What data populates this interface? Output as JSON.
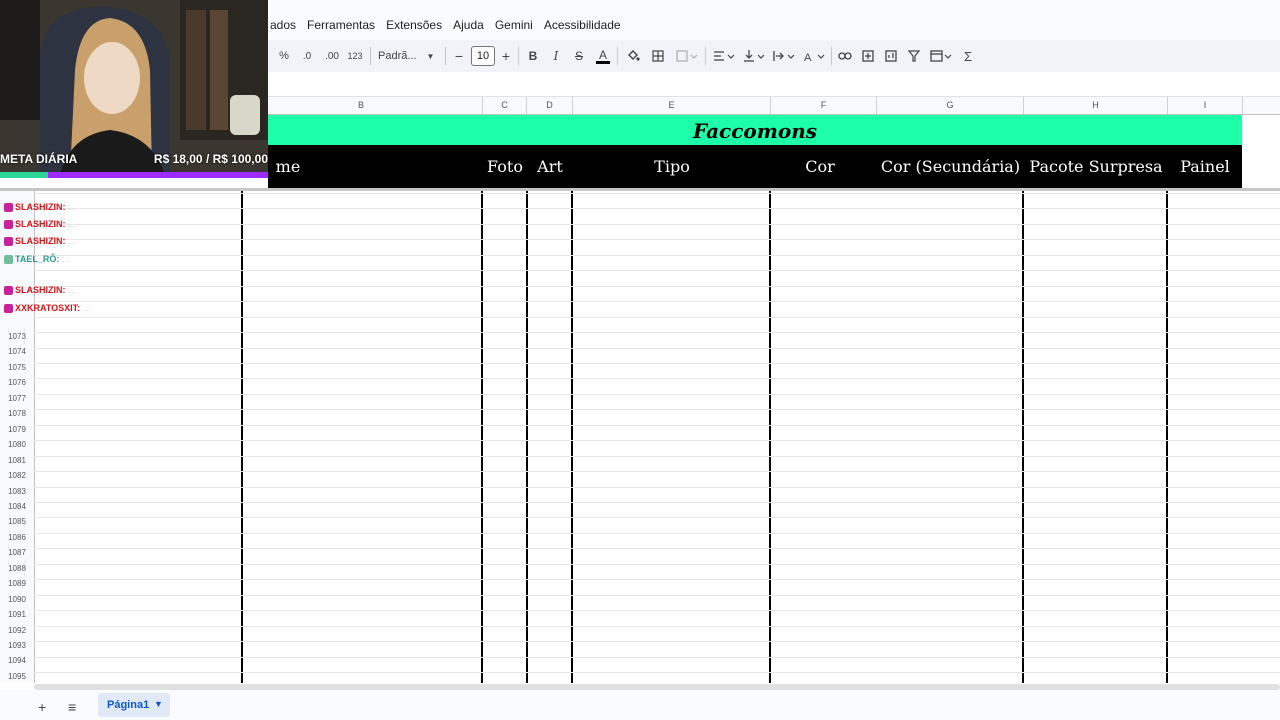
{
  "menu": {
    "items": [
      "ados",
      "Ferramentas",
      "Extensões",
      "Ajuda",
      "Gemini",
      "Acessibilidade"
    ]
  },
  "toolbar": {
    "percent": "%",
    "dec_decrease": ".0",
    "dec_increase": ".00",
    "number_format": "123",
    "font_name": "Padrã...",
    "font_size": "10",
    "bold": "B",
    "italic": "I",
    "strikethrough": "S",
    "text_color": "A",
    "minus": "−",
    "plus": "+",
    "sigma": "Σ"
  },
  "columns": [
    "B",
    "C",
    "D",
    "E",
    "F",
    "G",
    "H",
    "I"
  ],
  "sheet": {
    "title": "Faccomons",
    "headers": [
      "me",
      "Foto",
      "Art",
      "Tipo",
      "Cor",
      "Cor (Secundária)",
      "Pacote Surpresa",
      "Painel"
    ]
  },
  "rows": {
    "numbers": [
      "1073",
      "1074",
      "1075",
      "1076",
      "1077",
      "1078",
      "1079",
      "1080",
      "1081",
      "1082",
      "1083",
      "1084",
      "1085",
      "1086",
      "1087",
      "1088",
      "1089",
      "1090",
      "1091",
      "1092",
      "1093",
      "1094",
      "1095"
    ]
  },
  "overlay": {
    "meta_label": "META DIÁRIA",
    "meta_amount": "R$ 18,00 / R$ 100,00",
    "meta_progress": 0.18
  },
  "chat": [
    {
      "user": "SLASHIZIN:",
      "color": "#d9141b",
      "msg": "..."
    },
    {
      "user": "SLASHIZIN:",
      "color": "#d9141b",
      "msg": "..."
    },
    {
      "user": "SLASHIZIN:",
      "color": "#d9141b",
      "msg": "..."
    },
    {
      "user": "TAEL_RÔ:",
      "color": "#2e9a8e",
      "msg": "..."
    },
    {
      "user": "SLASHIZIN:",
      "color": "#d9141b",
      "msg": "..."
    },
    {
      "user": "XXKRATOSXIT:",
      "color": "#d9141b",
      "msg": "..."
    }
  ],
  "sheets": {
    "tab_label": "Página1",
    "add": "+",
    "all": "≡"
  },
  "colors": {
    "title_band": "#1dffa9",
    "header_band": "#000000",
    "meta_bar": "#9e2bff",
    "meta_fill": "#29d696"
  }
}
